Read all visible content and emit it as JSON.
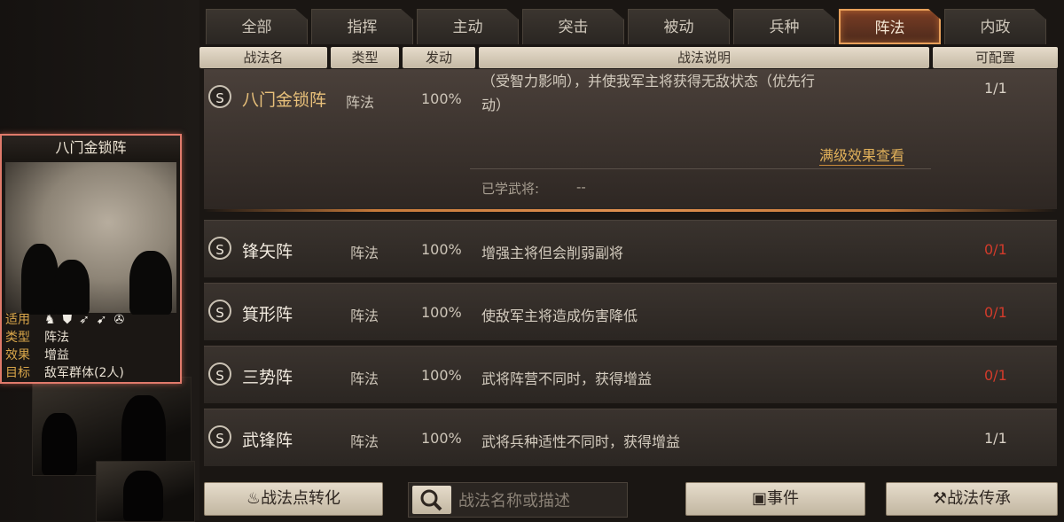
{
  "tabs": [
    "全部",
    "指挥",
    "主动",
    "突击",
    "被动",
    "兵种",
    "阵法",
    "内政"
  ],
  "active_tab": "阵法",
  "columns": {
    "name": "战法名",
    "type": "类型",
    "trigger": "发动",
    "desc": "战法说明",
    "config": "可配置"
  },
  "card": {
    "title": "八门金锁阵",
    "applicable_label": "适用",
    "type_label": "类型",
    "type_value": "阵法",
    "effect_label": "效果",
    "effect_value": "增益",
    "target_label": "目标",
    "target_value": "敌军群体(2人)",
    "unit_icons": [
      "cavalry-icon",
      "shield-icon",
      "bow-icon",
      "spear-icon",
      "chariot-icon"
    ]
  },
  "expanded": {
    "badge": "S",
    "name": "八门金锁阵",
    "type": "阵法",
    "rate": "100%",
    "desc_line1": "（受智力影响），并使我军主将获得无敌状态（优先行",
    "desc_line2": "动）",
    "count": "1/1",
    "full_effect_link": "满级效果查看",
    "learned_label": "已学武将:",
    "learned_value": "--"
  },
  "rows": [
    {
      "badge": "S",
      "name": "锋矢阵",
      "type": "阵法",
      "rate": "100%",
      "desc": "增强主将但会削弱副将",
      "count": "0/1"
    },
    {
      "badge": "S",
      "name": "箕形阵",
      "type": "阵法",
      "rate": "100%",
      "desc": "使敌军主将造成伤害降低",
      "count": "0/1"
    },
    {
      "badge": "S",
      "name": "三势阵",
      "type": "阵法",
      "rate": "100%",
      "desc": "武将阵营不同时，获得增益",
      "count": "0/1"
    },
    {
      "badge": "S",
      "name": "武锋阵",
      "type": "阵法",
      "rate": "100%",
      "desc": "武将兵种适性不同时，获得增益",
      "count": "1/1"
    }
  ],
  "bottom": {
    "convert_label": "战法点转化",
    "search_placeholder": "战法名称或描述",
    "events_label": "事件",
    "inherit_label": "战法传承"
  },
  "colors": {
    "accent_orange": "#e8a05a",
    "count_red": "#d23b2b",
    "link_gold": "#e0b05a"
  }
}
